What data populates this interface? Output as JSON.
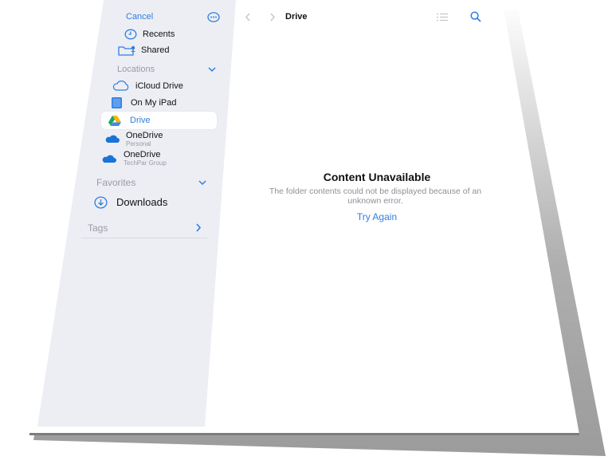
{
  "sidebar": {
    "cancel_label": "Cancel",
    "items": [
      {
        "label": "Recents",
        "icon": "clock-icon"
      },
      {
        "label": "Shared",
        "icon": "shared-folder-icon"
      }
    ],
    "locations": {
      "header": "Locations",
      "items": [
        {
          "label": "iCloud Drive",
          "icon": "cloud-icon"
        },
        {
          "label": "On My iPad",
          "icon": "ipad-icon"
        },
        {
          "label": "Drive",
          "icon": "google-drive-icon",
          "selected": true
        },
        {
          "label": "OneDrive",
          "sublabel": "Personal",
          "icon": "onedrive-icon"
        },
        {
          "label": "OneDrive",
          "sublabel": "TechPar Group",
          "icon": "onedrive-icon"
        }
      ]
    },
    "favorites": {
      "header": "Favorites",
      "items": [
        {
          "label": "Downloads",
          "icon": "download-circle-icon"
        }
      ]
    },
    "tags": {
      "header": "Tags"
    }
  },
  "toolbar": {
    "title": "Drive"
  },
  "main": {
    "heading": "Content Unavailable",
    "message_line1": "The folder contents could not be displayed because of an",
    "message_line2": "unknown error.",
    "retry_label": "Try Again"
  },
  "colors": {
    "accent": "#2f7de1",
    "sidebar_bg": "#eceef4",
    "selected_bg": "#ffffff"
  }
}
